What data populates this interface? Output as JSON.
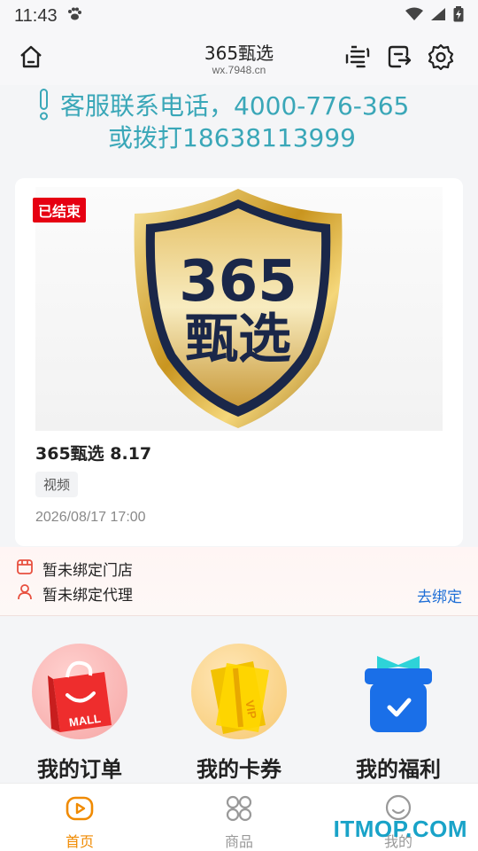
{
  "status_bar": {
    "time": "11:43"
  },
  "header": {
    "title": "365甄选",
    "subtitle": "wx.7948.cn"
  },
  "notice": {
    "line1": "客服联系电话，4000-776-365",
    "line2": "或拨打18638113999"
  },
  "card": {
    "badge": "已结束",
    "logo_line1": "365",
    "logo_line2": "甄选",
    "title": "365甄选 8.17",
    "tag": "视频",
    "date": "2026/08/17 17:00"
  },
  "binding": {
    "store": "暂未绑定门店",
    "agent": "暂未绑定代理",
    "action": "去绑定"
  },
  "features": [
    {
      "label": "我的订单",
      "icon": "shopping-bag-icon",
      "icon_text": "MALL"
    },
    {
      "label": "我的卡券",
      "icon": "vip-card-icon",
      "icon_text": "VIP"
    },
    {
      "label": "我的福利",
      "icon": "gift-box-icon"
    }
  ],
  "tabs": [
    {
      "label": "首页",
      "icon": "home-play-icon",
      "active": true
    },
    {
      "label": "商品",
      "icon": "grid-icon",
      "active": false
    },
    {
      "label": "我的",
      "icon": "smile-icon",
      "active": false
    }
  ],
  "watermark": "ITMOP.COM",
  "colors": {
    "accent": "#f08a00",
    "notice": "#3aa7b8",
    "link": "#1f6fd6",
    "badge": "#e60012"
  }
}
